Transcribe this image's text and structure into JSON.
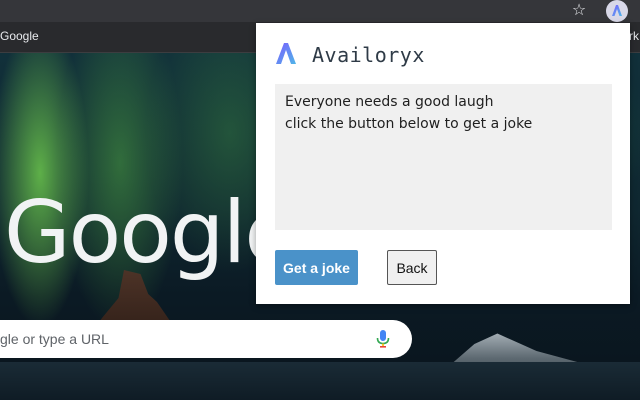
{
  "browser": {
    "bookmark_label": "Google",
    "bookmark_right_fragment": "rk",
    "star_icon": "star-icon",
    "extension_icon": "availoryx-extension-icon"
  },
  "ntp": {
    "logo_text": "Google",
    "search_placeholder": "gle or type a URL",
    "mic_icon": "microphone-icon"
  },
  "popup": {
    "brand_name": "Availoryx",
    "joke_lines": [
      "Everyone needs a good laugh",
      "click the button below to get a joke"
    ],
    "get_joke_label": "Get a joke",
    "back_label": "Back"
  },
  "colors": {
    "accent_button": "#4a92c9",
    "brand_gradient_start": "#7b5cff",
    "brand_gradient_end": "#4fb6e8"
  }
}
